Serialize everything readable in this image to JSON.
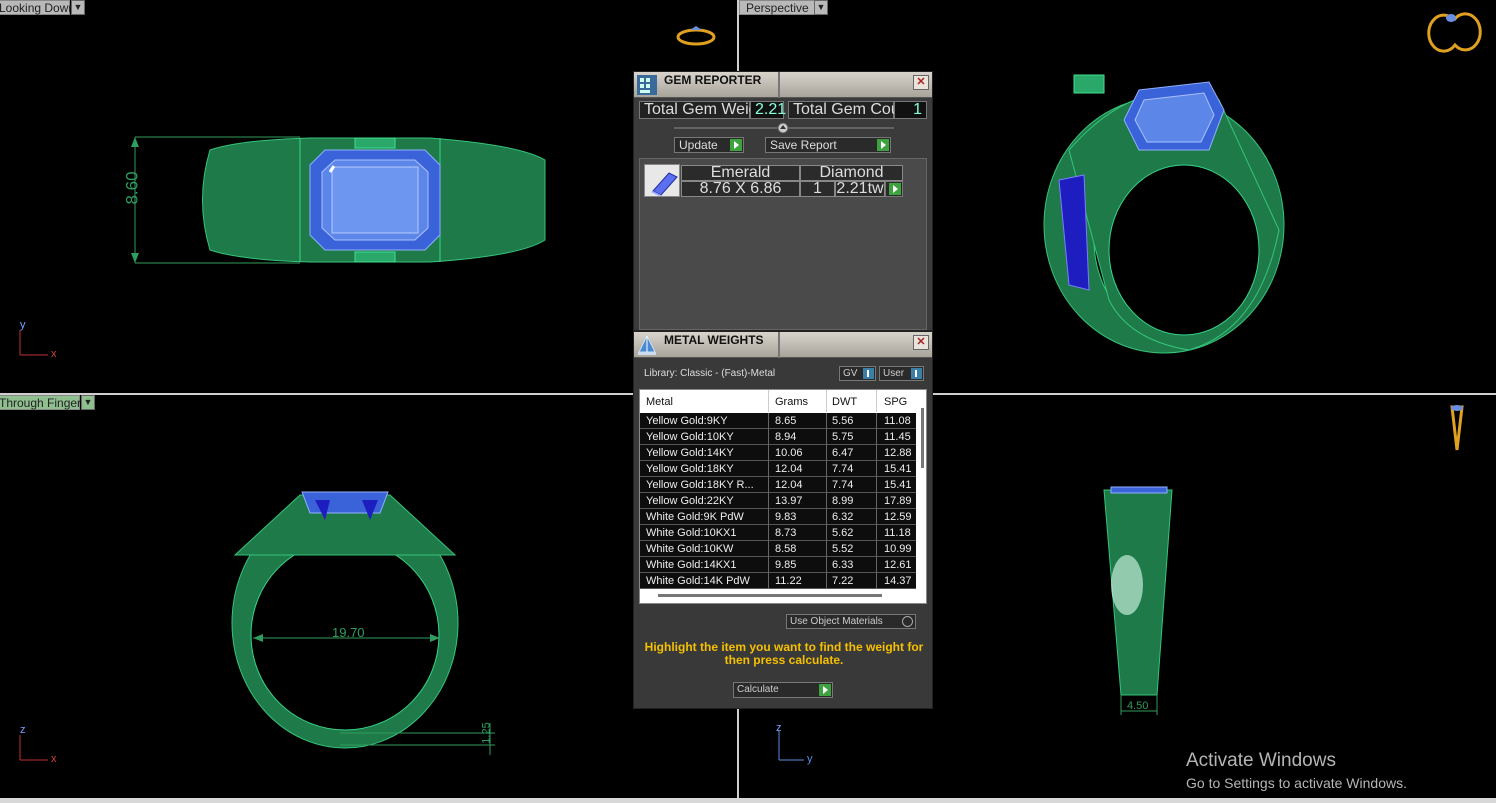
{
  "viewports": {
    "top": {
      "label": "Looking Down"
    },
    "perspective": {
      "label": "Perspective"
    },
    "front": {
      "label": "Through Finger"
    },
    "side": {
      "label": ""
    }
  },
  "dimensions": {
    "height": "8.60",
    "inner_diameter": "19.70",
    "thickness": "1.25",
    "width_bottom": "4.50"
  },
  "axes": {
    "top": [
      "y",
      "x"
    ],
    "front": [
      "z",
      "x"
    ],
    "side": [
      "z",
      "y"
    ]
  },
  "gem_reporter": {
    "title": "GEM REPORTER",
    "total_weight_label": "Total Gem Weight",
    "total_weight_value": "2.21",
    "total_count_label": "Total Gem Count",
    "total_count_value": "1",
    "update_label": "Update",
    "save_report_label": "Save Report",
    "gem": {
      "cut": "Emerald",
      "size": "8.76 X 6.86",
      "material": "Diamond",
      "count": "1",
      "weight": "2.21tw"
    }
  },
  "metal_weights": {
    "title": "METAL WEIGHTS",
    "library": "Library: Classic - (Fast)-Metal",
    "gv_label": "GV",
    "user_label": "User",
    "columns": [
      "Metal",
      "Grams",
      "DWT",
      "SPG"
    ],
    "rows": [
      [
        "Yellow Gold:9KY",
        "8.65",
        "5.56",
        "11.08"
      ],
      [
        "Yellow Gold:10KY",
        "8.94",
        "5.75",
        "11.45"
      ],
      [
        "Yellow Gold:14KY",
        "10.06",
        "6.47",
        "12.88"
      ],
      [
        "Yellow Gold:18KY",
        "12.04",
        "7.74",
        "15.41"
      ],
      [
        "Yellow Gold:18KY R...",
        "12.04",
        "7.74",
        "15.41"
      ],
      [
        "Yellow Gold:22KY",
        "13.97",
        "8.99",
        "17.89"
      ],
      [
        "White Gold:9K PdW",
        "9.83",
        "6.32",
        "12.59"
      ],
      [
        "White Gold:10KX1",
        "8.73",
        "5.62",
        "11.18"
      ],
      [
        "White Gold:10KW",
        "8.58",
        "5.52",
        "10.99"
      ],
      [
        "White Gold:14KX1",
        "9.85",
        "6.33",
        "12.61"
      ],
      [
        "White Gold:14K PdW",
        "11.22",
        "7.22",
        "14.37"
      ]
    ],
    "use_object_materials_label": "Use Object Materials",
    "hint": "Highlight the item you want to find the weight for then press calculate.",
    "calculate_label": "Calculate"
  },
  "watermark": {
    "line1": "Activate Windows",
    "line2": "Go to Settings to activate Windows."
  }
}
